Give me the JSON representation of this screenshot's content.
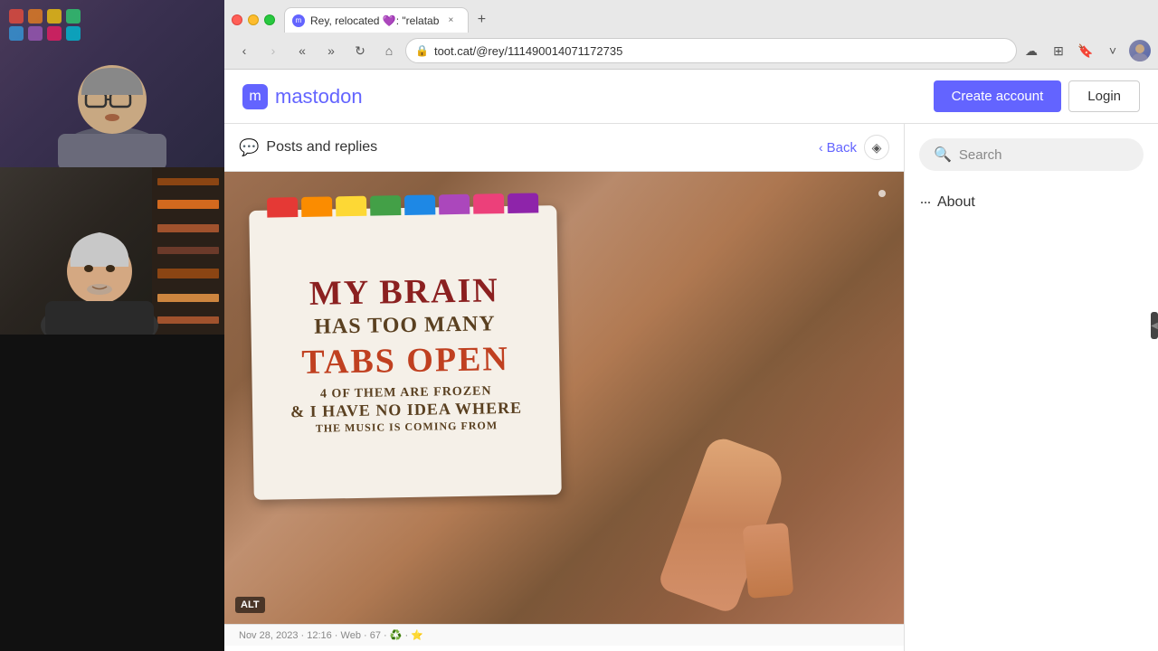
{
  "browser": {
    "tab": {
      "title": "Rey, relocated 💜: \"relatab",
      "favicon": "m"
    },
    "new_tab_label": "+",
    "nav": {
      "back_label": "‹",
      "forward_label": "›",
      "history_back_label": "«",
      "history_forward_label": "»",
      "refresh_label": "↻",
      "home_label": "⌂"
    },
    "url": "toot.cat/@rey/111490014071172735",
    "security_label": "🔒",
    "controls": {
      "cloud": "☁",
      "downloads": "⬜",
      "bookmark": "🔖",
      "chevron": "˅"
    }
  },
  "mastodon": {
    "logo_text": "mastodon",
    "logo_letter": "m",
    "header": {
      "create_account": "Create account",
      "login": "Login"
    },
    "posts_section": {
      "title": "Posts and replies",
      "icon": "💬",
      "back": "Back",
      "shield": "◈"
    },
    "post": {
      "image_alt": "ALT",
      "sign": {
        "line1": "MY BRAIN",
        "line2": "HAS TOO MANY",
        "line3": "TABS OPEN",
        "line4": "4 OF THEM ARE FROZEN",
        "line5": "& I HAVE NO IDEA WHERE",
        "line6": "THE MUSIC IS COMING FROM"
      },
      "tabs_colors": [
        "#e53935",
        "#fb8c00",
        "#fdd835",
        "#43a047",
        "#1e88e5",
        "#8e24aa",
        "#e91e63",
        "#9c27b0"
      ]
    },
    "sidebar": {
      "search_placeholder": "Search",
      "about_label": "About"
    },
    "footer": {
      "timestamp": "Nov 28, 2023 · 12:16 · Web · 67 · ♻️ · ⭐"
    }
  },
  "videos": {
    "person1": {
      "label": "Person 1 video feed"
    },
    "person2": {
      "label": "Person 2 video feed"
    }
  }
}
